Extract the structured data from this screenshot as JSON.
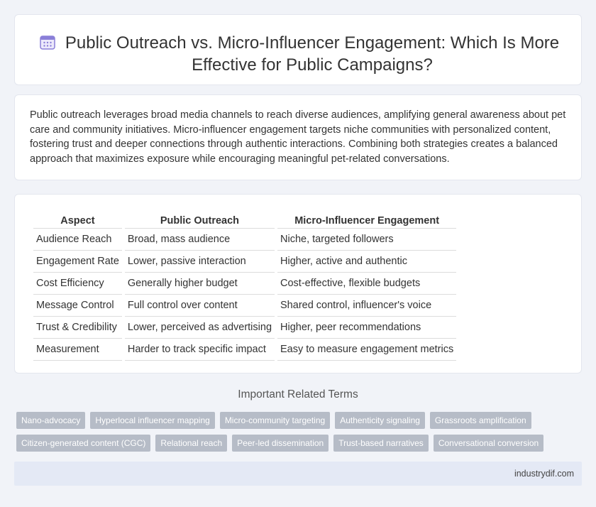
{
  "header": {
    "title": "Public Outreach vs. Micro-Influencer Engagement: Which Is More Effective for Public Campaigns?",
    "icon": "calendar-icon",
    "icon_color": "#8a7fd8"
  },
  "intro": {
    "text": "Public outreach leverages broad media channels to reach diverse audiences, amplifying general awareness about pet care and community initiatives. Micro-influencer engagement targets niche communities with personalized content, fostering trust and deeper connections through authentic interactions. Combining both strategies creates a balanced approach that maximizes exposure while encouraging meaningful pet-related conversations."
  },
  "table": {
    "headers": [
      "Aspect",
      "Public Outreach",
      "Micro-Influencer Engagement"
    ],
    "rows": [
      [
        "Audience Reach",
        "Broad, mass audience",
        "Niche, targeted followers"
      ],
      [
        "Engagement Rate",
        "Lower, passive interaction",
        "Higher, active and authentic"
      ],
      [
        "Cost Efficiency",
        "Generally higher budget",
        "Cost-effective, flexible budgets"
      ],
      [
        "Message Control",
        "Full control over content",
        "Shared control, influencer's voice"
      ],
      [
        "Trust & Credibility",
        "Lower, perceived as advertising",
        "Higher, peer recommendations"
      ],
      [
        "Measurement",
        "Harder to track specific impact",
        "Easy to measure engagement metrics"
      ]
    ]
  },
  "terms": {
    "heading": "Important Related Terms",
    "row1": [
      "Nano-advocacy",
      "Hyperlocal influencer mapping",
      "Micro-community targeting",
      "Authenticity signaling",
      "Grassroots amplification"
    ],
    "row2": [
      "Citizen-generated content (CGC)",
      "Relational reach",
      "Peer-led dissemination",
      "Trust-based narratives",
      "Conversational conversion"
    ],
    "tag_color": "#b6bcc7"
  },
  "footer": {
    "site": "industrydif.com"
  }
}
